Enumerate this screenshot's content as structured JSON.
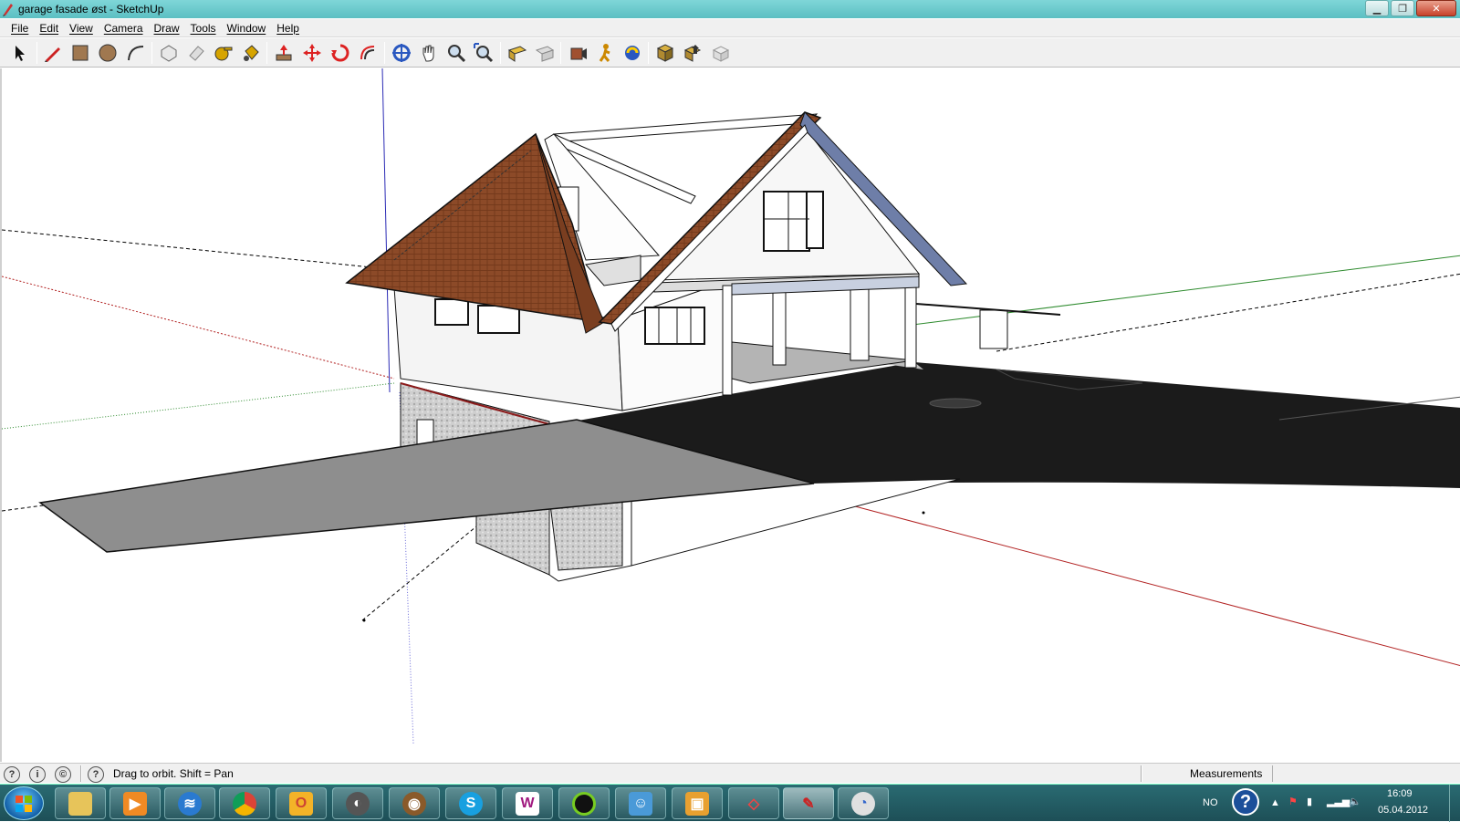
{
  "window": {
    "title": "garage fasade øst - SketchUp",
    "minimize": "▁",
    "maximize": "❐",
    "close": "✕"
  },
  "menu": [
    "File",
    "Edit",
    "View",
    "Camera",
    "Draw",
    "Tools",
    "Window",
    "Help"
  ],
  "toolbar": {
    "tools": [
      "select-tool",
      "pencil-line-tool",
      "rectangle-tool",
      "circle-tool",
      "arc-tool",
      "make-component-tool",
      "eraser-tool",
      "tape-measure-tool",
      "paint-bucket-tool",
      "push-pull-tool",
      "move-tool",
      "rotate-tool",
      "offset-tool",
      "orbit-tool",
      "pan-tool",
      "zoom-tool",
      "zoom-extents-tool",
      "previous-view-tool",
      "next-view-tool",
      "position-camera-tool",
      "walk-tool",
      "look-around-tool",
      "get-models-tool",
      "share-model-tool",
      "components-tool"
    ]
  },
  "status": {
    "message": "Drag to orbit.  Shift = Pan",
    "measurements_label": "Measurements",
    "measurements_value": "",
    "help_icon": "?"
  },
  "taskbar": {
    "language": "NO",
    "time": "16:09",
    "date": "05.04.2012",
    "apps": [
      "explorer",
      "media-player",
      "wifi-manager",
      "chrome",
      "outlook",
      "winamp",
      "owl-app",
      "skype",
      "w-app",
      "circle-app",
      "people-app",
      "photos-app",
      "sketchup-3d",
      "sketchup",
      "paint"
    ]
  },
  "colors": {
    "roof": "#8c4a28",
    "asphalt": "#1b1b1b",
    "ramp": "#8e8e8e",
    "axis_red": "#b22222",
    "axis_green": "#2e8b2e",
    "axis_blue": "#2b2bb5"
  }
}
